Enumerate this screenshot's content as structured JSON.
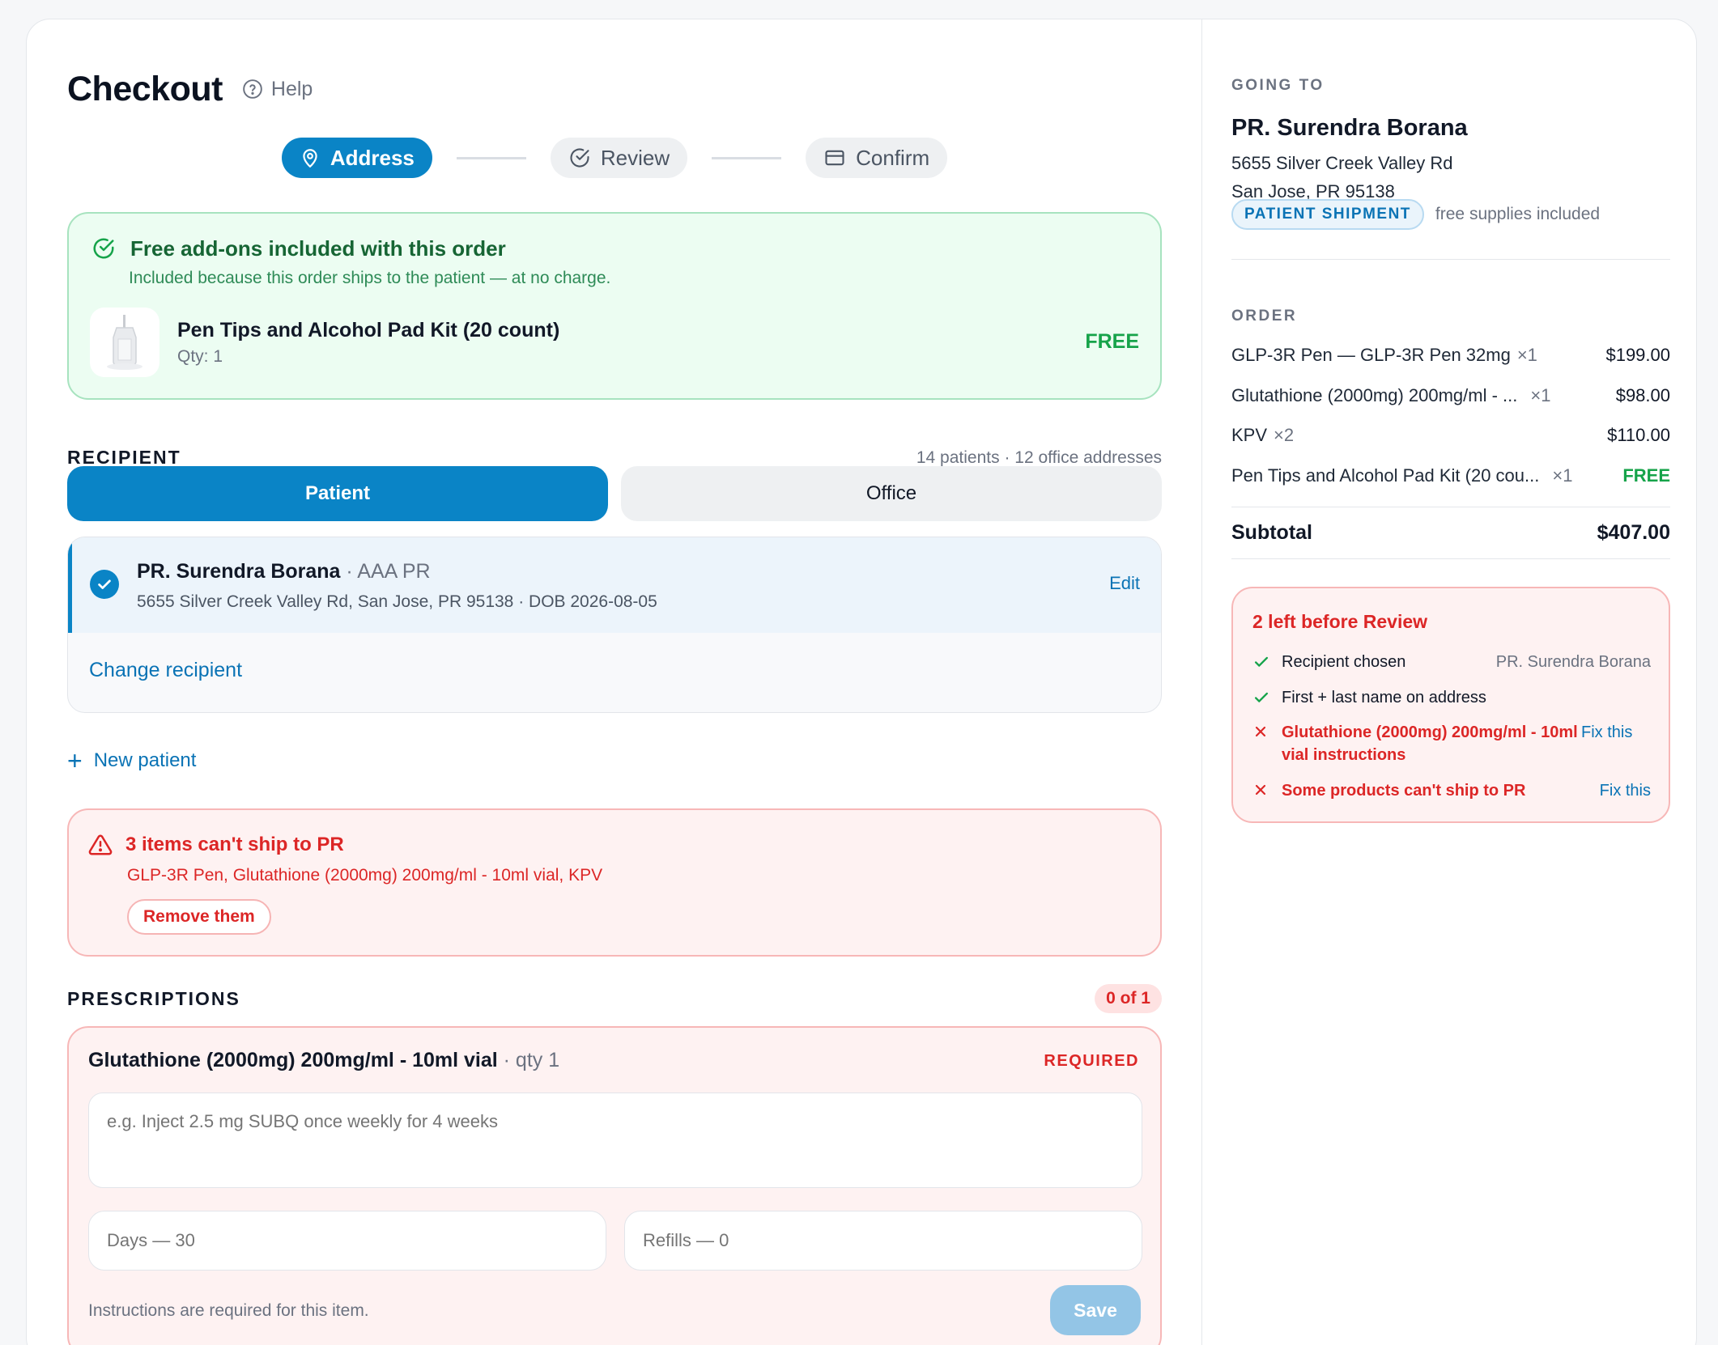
{
  "header": {
    "title": "Checkout",
    "help_label": "Help"
  },
  "steps": [
    {
      "label": "Address",
      "icon": "map-pin-icon",
      "active": true
    },
    {
      "label": "Review",
      "icon": "check-circle-icon",
      "active": false
    },
    {
      "label": "Confirm",
      "icon": "credit-card-icon",
      "active": false
    }
  ],
  "addons": {
    "title": "Free add-ons included with this order",
    "subtitle": "Included because this order ships to the patient — at no charge.",
    "item_name": "Pen Tips and Alcohol Pad Kit (20 count)",
    "item_qty": "Qty: 1",
    "price": "FREE"
  },
  "recipient": {
    "section_title": "RECIPIENT",
    "meta": "14 patients · 12 office addresses",
    "toggle": {
      "patient": "Patient",
      "office": "Office"
    },
    "selected": {
      "name": "PR. Surendra Borana",
      "org": " · AAA PR",
      "address": "5655 Silver Creek Valley Rd, San Jose, PR 95138 · DOB 2026-08-05",
      "edit_label": "Edit"
    },
    "change_label": "Change recipient",
    "new_patient_label": "New patient"
  },
  "shipping_error": {
    "title": "3 items can't ship to PR",
    "items": "GLP-3R Pen, Glutathione (2000mg) 200mg/ml - 10ml vial, KPV",
    "button": "Remove them"
  },
  "prescriptions": {
    "section_title": "PRESCRIPTIONS",
    "count": "0 of 1",
    "item": {
      "name": "Glutathione (2000mg) 200mg/ml - 10ml vial",
      "qty": " · qty 1",
      "required_label": "REQUIRED",
      "instructions_placeholder": "e.g. Inject 2.5 mg SUBQ once weekly for 4 weeks",
      "days_placeholder": "Days — 30",
      "refills_placeholder": "Refills — 0",
      "help_text": "Instructions are required for this item.",
      "save_label": "Save"
    }
  },
  "summary": {
    "going_to_label": "GOING TO",
    "name": "PR. Surendra Borana",
    "address_line1": "5655 Silver Creek Valley Rd",
    "address_line2": "San Jose, PR 95138",
    "tag": "PATIENT SHIPMENT",
    "tag_note": "free supplies included",
    "order_label": "ORDER",
    "order_items": [
      {
        "name": "GLP-3R Pen — GLP-3R Pen 32mg",
        "qty": "×1",
        "price": "$199.00"
      },
      {
        "name": "Glutathione (2000mg) 200mg/ml - ...",
        "qty": "×1",
        "price": "$98.00"
      },
      {
        "name": "KPV",
        "qty": "×2",
        "price": "$110.00"
      },
      {
        "name": "Pen Tips and Alcohol Pad Kit (20 cou...",
        "qty": "×1",
        "price": "FREE"
      }
    ],
    "subtotal_label": "Subtotal",
    "subtotal_value": "$407.00"
  },
  "checklist": {
    "title": "2 left before Review",
    "items": [
      {
        "status": "done",
        "text": "Recipient chosen",
        "aside": "PR. Surendra Borana"
      },
      {
        "status": "done",
        "text": "First + last name on address"
      },
      {
        "status": "todo",
        "text": "Glutathione (2000mg) 200mg/ml - 10ml vial instructions",
        "action": "Fix this"
      },
      {
        "status": "todo",
        "text": "Some products can't ship to PR",
        "action": "Fix this"
      }
    ]
  },
  "colors": {
    "primary": "#0a84c6",
    "success": "#16a34a",
    "danger": "#dc2626"
  }
}
